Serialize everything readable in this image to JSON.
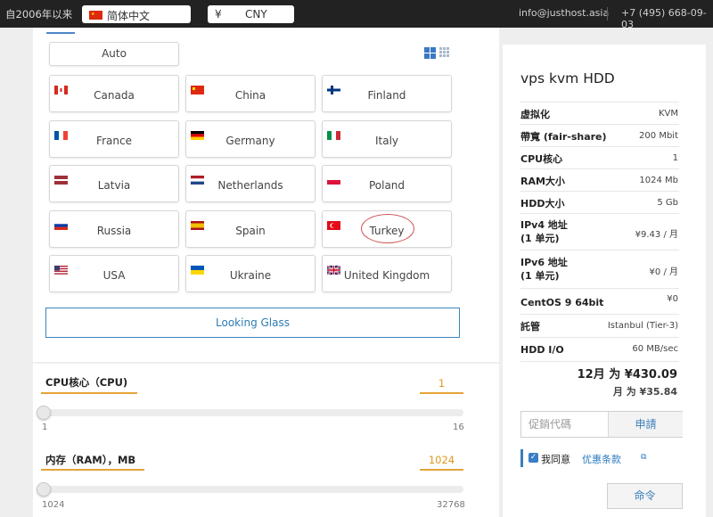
{
  "topbar": {
    "since": "自2006年以来",
    "language": "简体中文",
    "currency_symbol": "¥",
    "currency": "CNY",
    "email": "info@justhost.asia",
    "phone": "+7 (495) 668-09-03"
  },
  "locations": {
    "auto": "Auto",
    "items": [
      {
        "label": "Canada",
        "flag": "ca"
      },
      {
        "label": "China",
        "flag": "cn"
      },
      {
        "label": "Finland",
        "flag": "fi"
      },
      {
        "label": "France",
        "flag": "fr"
      },
      {
        "label": "Germany",
        "flag": "de"
      },
      {
        "label": "Italy",
        "flag": "it"
      },
      {
        "label": "Latvia",
        "flag": "lv"
      },
      {
        "label": "Netherlands",
        "flag": "nl"
      },
      {
        "label": "Poland",
        "flag": "pl"
      },
      {
        "label": "Russia",
        "flag": "ru"
      },
      {
        "label": "Spain",
        "flag": "es"
      },
      {
        "label": "Turkey",
        "flag": "tr",
        "highlighted": true
      },
      {
        "label": "USA",
        "flag": "us"
      },
      {
        "label": "Ukraine",
        "flag": "ua"
      },
      {
        "label": "United Kingdom",
        "flag": "gb"
      }
    ],
    "looking_glass": "Looking Glass"
  },
  "sliders": {
    "cpu": {
      "label": "CPU核心（CPU)",
      "value": "1",
      "min": "1",
      "max": "16",
      "level": 0
    },
    "ram": {
      "label": "内存（RAM），MB",
      "value": "1024",
      "min": "1024",
      "max": "32768",
      "level": 0
    }
  },
  "summary": {
    "title": "vps kvm HDD",
    "specs": [
      {
        "label": "虚拟化",
        "value": "KVM"
      },
      {
        "label": "帶寬 (fair-share)",
        "value": "200 Mbit"
      },
      {
        "label": "CPU核心",
        "value": "1"
      },
      {
        "label": "RAM大小",
        "value": "1024 Mb"
      },
      {
        "label": "HDD大小",
        "value": "5 Gb"
      },
      {
        "label": "IPv4 地址\n(1 单元)",
        "value": "¥9.43 / 月"
      },
      {
        "label": "IPv6 地址\n(1 单元)",
        "value": "¥0 / 月"
      },
      {
        "label": "CentOS 9 64bit",
        "value": "¥0"
      },
      {
        "label": "託管",
        "value": "Istanbul (Tier-3)"
      },
      {
        "label": "HDD I/O",
        "value": "60 MB/sec"
      }
    ],
    "total_monthly": "12月 为 ¥430.09",
    "total_per_month": "月 为 ¥35.84",
    "promo_placeholder": "促銷代碼",
    "apply": "申請",
    "agree_text": "我同意",
    "agree_link": "优惠条款",
    "order": "命令"
  },
  "colors": {
    "accent": "#3c7fba",
    "slider_accent": "#e5a33a",
    "highlight_circle": "#d05050"
  }
}
